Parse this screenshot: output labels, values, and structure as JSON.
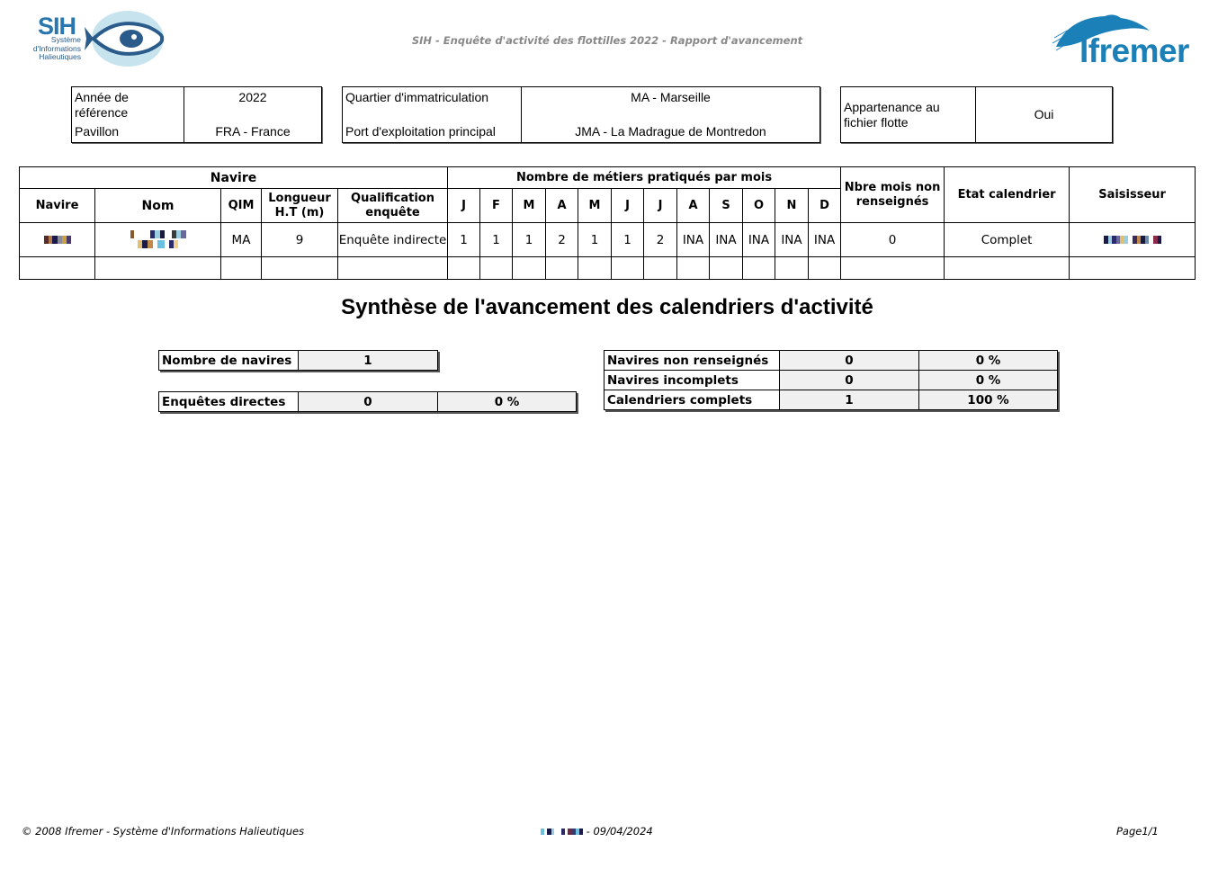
{
  "header": {
    "title": "SIH - Enquête d'activité des flottilles 2022 - Rapport d'avancement",
    "sih_logo_text": "SIH",
    "sih_logo_subtitle": [
      "Système",
      "d'Informations",
      "Halieutiques"
    ],
    "ifremer_logo_text": "Ifremer"
  },
  "info": {
    "annee_label": "Année de référence",
    "annee_value": "2022",
    "pavillon_label": "Pavillon",
    "pavillon_value": "FRA - France",
    "quartier_label": "Quartier d'immatriculation",
    "quartier_value": "MA - Marseille",
    "port_label": "Port d'exploitation principal",
    "port_value": "JMA - La Madrague de Montredon",
    "appartenance_label": "Appartenance au fichier flotte",
    "appartenance_value": "Oui"
  },
  "table": {
    "group_navire": "Navire",
    "group_metiers": "Nombre de métiers pratiqués par mois",
    "col_nbre_mois": "Nbre mois non renseignés",
    "col_etat": "Etat calendrier",
    "col_saisisseur": "Saisisseur",
    "col_navire": "Navire",
    "col_nom": "Nom",
    "col_qim": "QIM",
    "col_longueur": "Longueur H.T (m)",
    "col_qualification": "Qualification enquête",
    "months": [
      "J",
      "F",
      "M",
      "A",
      "M",
      "J",
      "J",
      "A",
      "S",
      "O",
      "N",
      "D"
    ],
    "rows": [
      {
        "qim": "MA",
        "longueur": "9",
        "qualification": "Enquête indirecte",
        "month_values": [
          "1",
          "1",
          "1",
          "2",
          "1",
          "1",
          "2",
          "INA",
          "INA",
          "INA",
          "INA",
          "INA"
        ],
        "nbre_mois": "0",
        "etat": "Complet"
      }
    ]
  },
  "synthese": {
    "title": "Synthèse de l'avancement des calendriers d'activité",
    "nombre_navires_label": "Nombre de navires",
    "nombre_navires_value": "1",
    "enquetes_directes_label": "Enquêtes directes",
    "enquetes_directes_value": "0",
    "enquetes_directes_pct": "0 %",
    "non_renseignes_label": "Navires non renseignés",
    "non_renseignes_value": "0",
    "non_renseignes_pct": "0 %",
    "incomplets_label": "Navires incomplets",
    "incomplets_value": "0",
    "incomplets_pct": "0 %",
    "complets_label": "Calendriers complets",
    "complets_value": "1",
    "complets_pct": "100 %"
  },
  "footer": {
    "copyright": "© 2008 Ifremer - Système d'Informations Halieutiques",
    "date": "- 09/04/2024",
    "page": "Page1/1"
  }
}
